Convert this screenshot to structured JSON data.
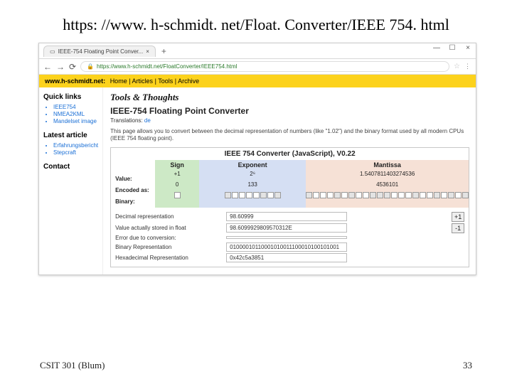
{
  "url_heading": "https: //www. h-schmidt. net/Float. Converter/IEEE 754. html",
  "tab": {
    "title": "IEEE-754 Floating Point Conver..."
  },
  "address": "https://www.h-schmidt.net/FloatConverter/IEEE754.html",
  "sitenav": {
    "brand": "www.h-schmidt.net:",
    "items": [
      "Home",
      "Articles",
      "Tools",
      "Archive"
    ]
  },
  "sidebar": {
    "quick_title": "Quick links",
    "quick_links": [
      "IEEE754",
      "NMEA2KML",
      "Mandelset image"
    ],
    "latest_title": "Latest article",
    "latest_items": [
      "Erfahrungsbericht",
      "Stepcraft"
    ],
    "contact": "Contact"
  },
  "main": {
    "section": "Tools & Thoughts",
    "title": "IEEE-754 Floating Point Converter",
    "translations_label": "Translations:",
    "translations_link": "de",
    "blurb": "This page allows you to convert between the decimal representation of numbers (like \"1.02\") and the binary format used by all modern CPUs (IEEE 754 floating point)."
  },
  "converter": {
    "head": "IEEE 754 Converter (JavaScript), V0.22",
    "row_labels": [
      "Value:",
      "Encoded as:",
      "Binary:"
    ],
    "sign": {
      "head": "Sign",
      "value": "+1",
      "encoded": "0"
    },
    "exponent": {
      "head": "Exponent",
      "value": "2⁶",
      "encoded": "133"
    },
    "mantissa": {
      "head": "Mantissa",
      "value": "1.5407811403274536",
      "encoded": "4536101"
    },
    "sign_bits": [
      0
    ],
    "exp_bits": [
      1,
      0,
      0,
      0,
      0,
      1,
      0,
      1
    ],
    "man_bits": [
      1,
      0,
      0,
      0,
      1,
      0,
      1,
      0,
      0,
      1,
      1,
      1,
      0,
      0,
      0,
      1,
      0,
      0,
      1,
      0,
      1,
      0,
      1
    ]
  },
  "lower": {
    "rows": [
      {
        "label": "Decimal representation",
        "value": "98.60999"
      },
      {
        "label": "Value actually stored in float",
        "value": "98.6099929809570312E"
      },
      {
        "label": "Error due to conversion:",
        "value": ""
      },
      {
        "label": "Binary Representation",
        "value": "01000010110001010011100010100101001"
      },
      {
        "label": "Hexadecimal Representation",
        "value": "0x42c5a3851"
      }
    ],
    "plus": "+1",
    "minus": "-1"
  },
  "footer": {
    "left": "CSIT 301 (Blum)",
    "right": "33"
  }
}
